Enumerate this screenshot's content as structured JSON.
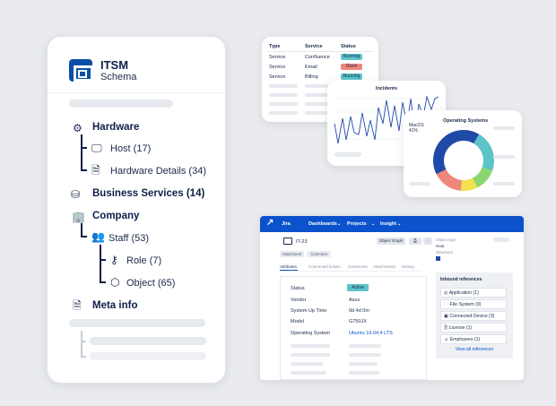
{
  "schema": {
    "title": "ITSM",
    "subtitle": "Schema",
    "sections": {
      "hardware": "Hardware",
      "host": "Host (17)",
      "hw_details": "Hardware Details (34)",
      "business": "Business Services (14)",
      "company": "Company",
      "staff": "Staff (53)",
      "role": "Role (7)",
      "object": "Object (65)",
      "meta": "Meta info"
    }
  },
  "services": {
    "headers": [
      "Type",
      "Service",
      "Status"
    ],
    "rows": [
      {
        "type": "Service",
        "service": "Confluence",
        "status": "Running",
        "color": "#5bc4c9"
      },
      {
        "type": "Service",
        "service": "Email",
        "status": "Down",
        "color": "#f0867b"
      },
      {
        "type": "Service",
        "service": "Billing",
        "status": "Running",
        "color": "#5bc4c9"
      }
    ]
  },
  "incidents": {
    "title": "Incidents"
  },
  "os": {
    "title": "Operating Systems",
    "label": "MacOS",
    "percent": "41%",
    "slices": [
      {
        "value": 41,
        "color": "#1f4aa8"
      },
      {
        "value": 22,
        "color": "#5bc4c9"
      },
      {
        "value": 12,
        "color": "#8bd66f"
      },
      {
        "value": 9,
        "color": "#f2e04d"
      },
      {
        "value": 16,
        "color": "#f0867b"
      }
    ]
  },
  "jira": {
    "logo": "Jira",
    "menu": [
      "Dashboards",
      "Projects",
      "Insight"
    ],
    "issue_id": "IT-23",
    "object_graph": "Object Graph",
    "chips": [
      "Attachment",
      "Comment"
    ],
    "tabs": [
      "Attributes",
      "Connected tickets",
      "Comments",
      "Attachments",
      "History"
    ],
    "object_type_label": "Object type",
    "object_type_value": "Host",
    "watchers_label": "Watchers",
    "fields": [
      {
        "label": "Status",
        "value": "Active"
      },
      {
        "label": "Vendor",
        "value": "Asus"
      },
      {
        "label": "System Up Time",
        "value": "0d 4d 0m"
      },
      {
        "label": "Model",
        "value": "G750JX"
      },
      {
        "label": "Operating System",
        "value": "Ubuntu 16.04.4 LTS"
      }
    ],
    "inbound_title": "Inbound references",
    "inbound": [
      "Application (1)",
      "File System (9)",
      "Connected Device (3)",
      "License (1)",
      "Employees (1)"
    ],
    "view_all": "View all references"
  }
}
